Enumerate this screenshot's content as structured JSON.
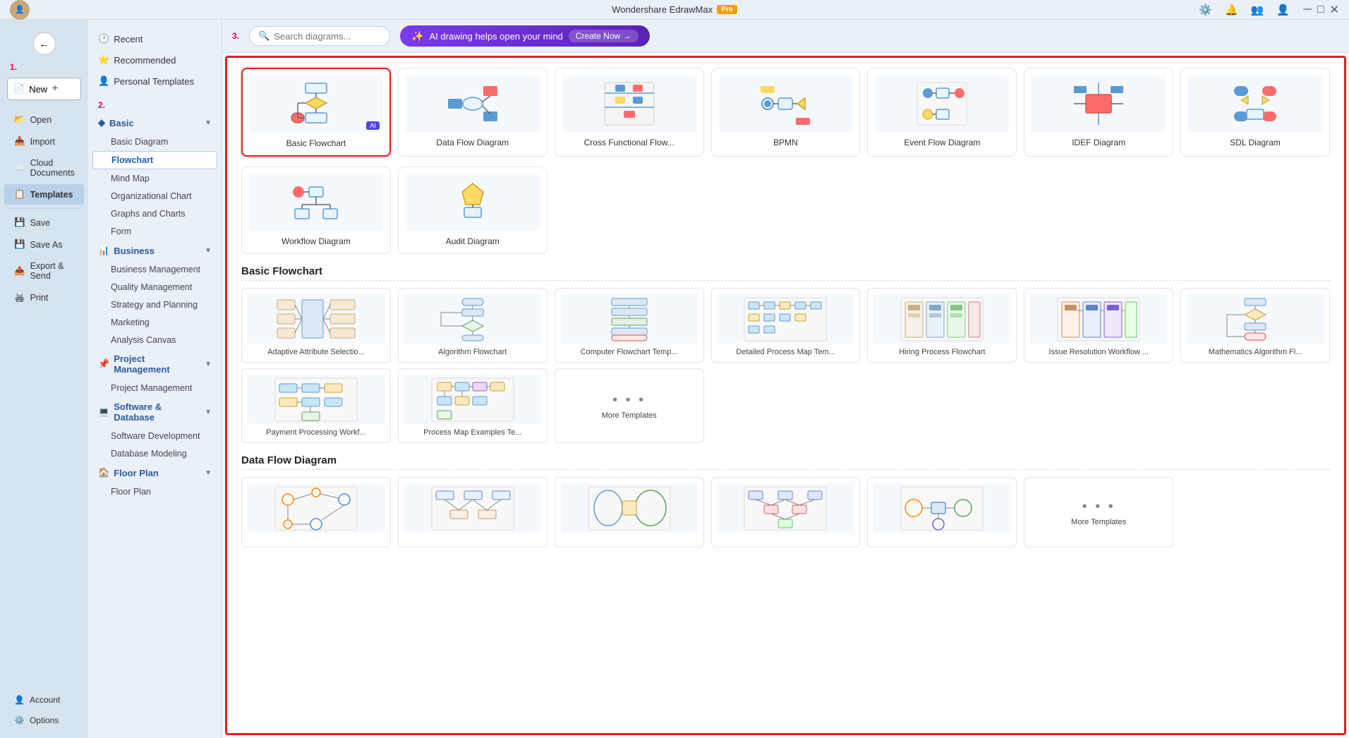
{
  "app": {
    "title": "Wondershare EdrawMax",
    "pro_badge": "Pro"
  },
  "titlebar": {
    "title": "Wondershare EdrawMax",
    "pro": "Pro",
    "controls": [
      "minimize",
      "maximize",
      "close"
    ]
  },
  "sidebar": {
    "label_1": "1.",
    "new_btn": "New",
    "items": [
      {
        "id": "open",
        "label": "Open",
        "icon": "📂"
      },
      {
        "id": "import",
        "label": "Import",
        "icon": "📥"
      },
      {
        "id": "cloud",
        "label": "Cloud Documents",
        "icon": "☁️"
      },
      {
        "id": "templates",
        "label": "Templates",
        "icon": "📋"
      },
      {
        "id": "save",
        "label": "Save",
        "icon": "💾"
      },
      {
        "id": "save-as",
        "label": "Save As",
        "icon": "💾"
      },
      {
        "id": "export",
        "label": "Export & Send",
        "icon": "📤"
      },
      {
        "id": "print",
        "label": "Print",
        "icon": "🖨️"
      }
    ],
    "bottom": [
      {
        "id": "account",
        "label": "Account",
        "icon": "👤"
      },
      {
        "id": "options",
        "label": "Options",
        "icon": "⚙️"
      }
    ]
  },
  "nav": {
    "label_2": "2.",
    "recent": "Recent",
    "recommended": "Recommended",
    "personal": "Personal Templates",
    "sections": [
      {
        "id": "basic",
        "label": "Basic",
        "items": [
          "Basic Diagram",
          "Flowchart",
          "Mind Map",
          "Organizational Chart",
          "Graphs and Charts",
          "Form"
        ]
      },
      {
        "id": "business",
        "label": "Business",
        "items": [
          "Business Management",
          "Quality Management",
          "Strategy and Planning",
          "Marketing",
          "Analysis Canvas"
        ]
      },
      {
        "id": "project",
        "label": "Project Management",
        "items": [
          "Project Management"
        ]
      },
      {
        "id": "software",
        "label": "Software & Database",
        "items": [
          "Software Development",
          "Database Modeling"
        ]
      },
      {
        "id": "floor",
        "label": "Floor Plan",
        "items": [
          "Floor Plan"
        ]
      }
    ]
  },
  "topbar": {
    "label_3": "3.",
    "search_placeholder": "Search diagrams...",
    "ai_text": "AI drawing helps open your mind",
    "ai_cta": "Create Now →"
  },
  "top_templates": [
    {
      "id": "basic-flowchart",
      "label": "Basic Flowchart",
      "selected": true,
      "has_ai": true
    },
    {
      "id": "data-flow",
      "label": "Data Flow Diagram",
      "selected": false,
      "has_ai": false
    },
    {
      "id": "cross-functional",
      "label": "Cross Functional Flow...",
      "selected": false,
      "has_ai": false
    },
    {
      "id": "bpmn",
      "label": "BPMN",
      "selected": false,
      "has_ai": false
    },
    {
      "id": "event-flow",
      "label": "Event Flow Diagram",
      "selected": false,
      "has_ai": false
    },
    {
      "id": "idef",
      "label": "IDEF Diagram",
      "selected": false,
      "has_ai": false
    },
    {
      "id": "sdl",
      "label": "SDL Diagram",
      "selected": false,
      "has_ai": false
    }
  ],
  "bottom_row_templates": [
    {
      "id": "workflow",
      "label": "Workflow Diagram"
    },
    {
      "id": "audit",
      "label": "Audit Diagram"
    }
  ],
  "sections": [
    {
      "id": "basic-flowchart",
      "title": "Basic Flowchart",
      "templates": [
        {
          "id": "adaptive",
          "label": "Adaptive Attribute Selectio..."
        },
        {
          "id": "algorithm",
          "label": "Algorithm Flowchart"
        },
        {
          "id": "computer",
          "label": "Computer Flowchart Temp..."
        },
        {
          "id": "detailed",
          "label": "Detailed Process Map Tem..."
        },
        {
          "id": "hiring",
          "label": "Hiring Process Flowchart"
        },
        {
          "id": "issue",
          "label": "Issue Resolution Workflow ..."
        },
        {
          "id": "math",
          "label": "Mathematics Algorithm Fl..."
        }
      ],
      "extra": [
        {
          "id": "payment",
          "label": "Payment Processing Workf..."
        },
        {
          "id": "process-map",
          "label": "Process Map Examples Te..."
        }
      ],
      "more": "More Templates"
    },
    {
      "id": "data-flow-diagram",
      "title": "Data Flow Diagram",
      "templates": [
        {
          "id": "dfd1",
          "label": ""
        },
        {
          "id": "dfd2",
          "label": ""
        },
        {
          "id": "dfd3",
          "label": ""
        },
        {
          "id": "dfd4",
          "label": ""
        },
        {
          "id": "dfd5",
          "label": ""
        }
      ],
      "more": "More Templates"
    }
  ]
}
